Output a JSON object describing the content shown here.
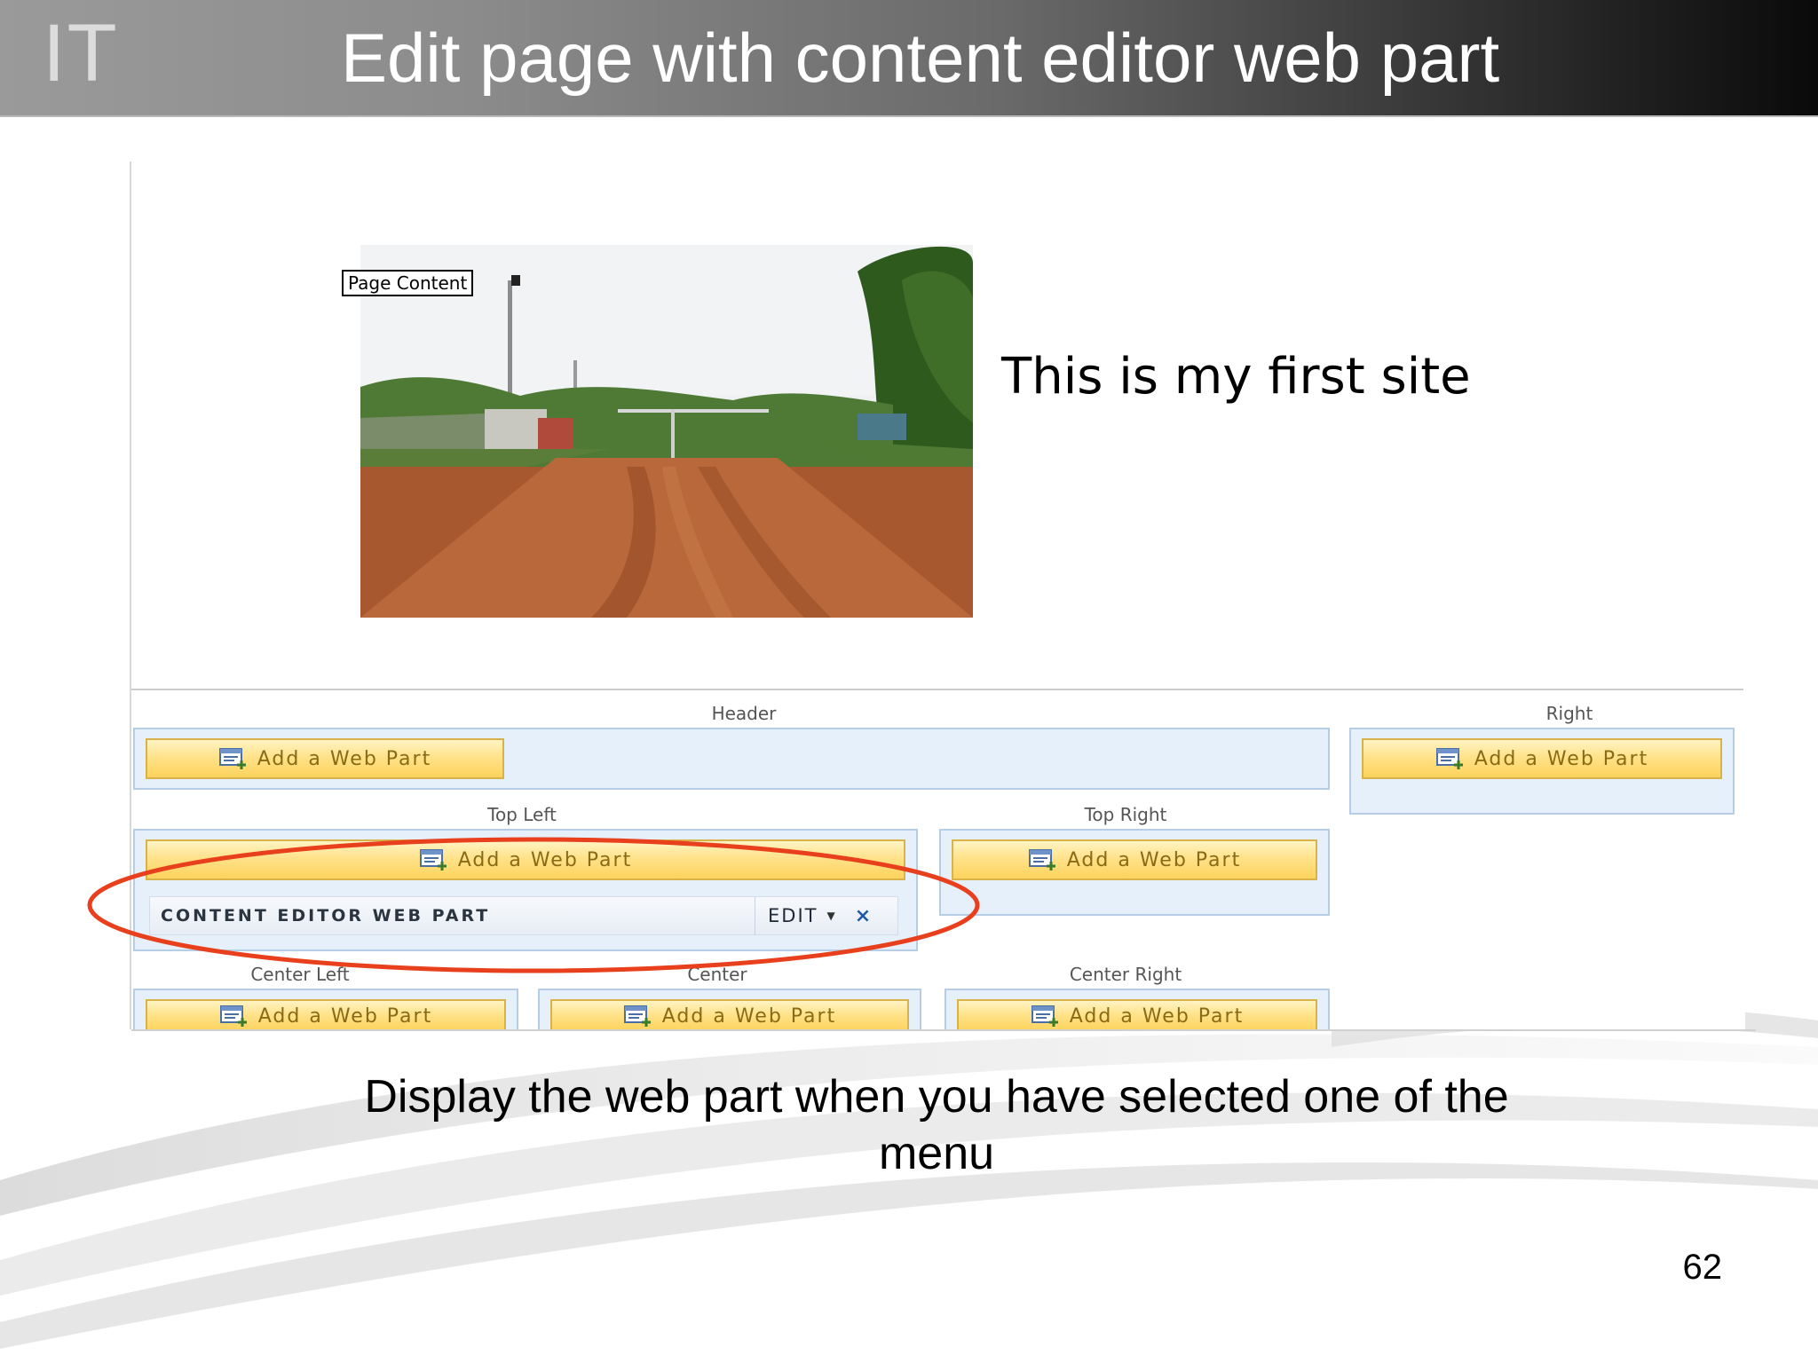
{
  "slide": {
    "logo": "IT",
    "title": "Edit page with content editor web part",
    "caption_line1": "Display the web part when you have selected one of the",
    "caption_line2": "menu",
    "page_number": "62"
  },
  "screenshot": {
    "page_content_tag": "Page Content",
    "site_heading": "This is my first site",
    "add_web_part_label": "Add a Web Part",
    "zones": {
      "header": "Header",
      "right": "Right",
      "top_left": "Top Left",
      "top_right": "Top Right",
      "center_left": "Center Left",
      "center": "Center",
      "center_right": "Center Right"
    },
    "web_part": {
      "title": "CONTENT EDITOR WEB PART",
      "edit_label": "EDIT",
      "close_glyph": "×"
    }
  },
  "colors": {
    "zone_fill": "#e5f0fb",
    "button_fill": "#ffe28a",
    "highlight_ring": "#e8401c"
  },
  "icons": [
    "web-part-add-icon",
    "chevron-down-icon",
    "close-icon"
  ]
}
